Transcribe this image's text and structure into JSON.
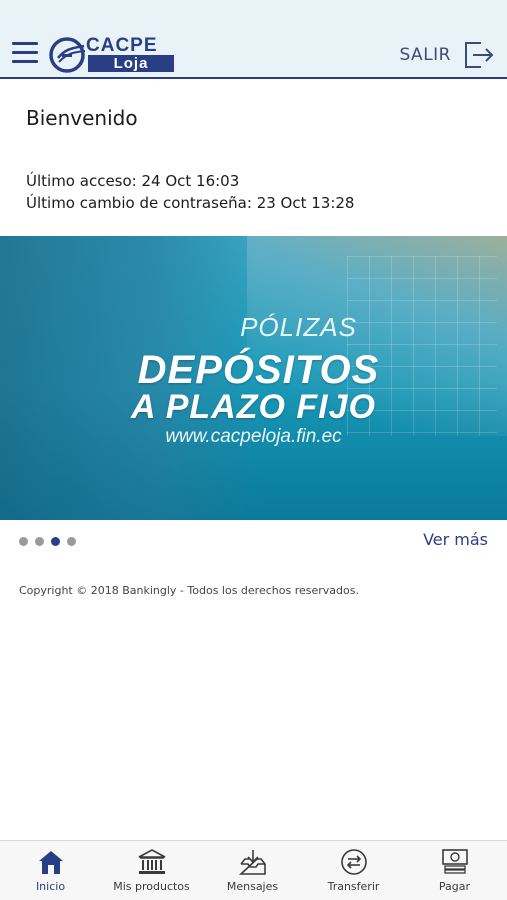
{
  "header": {
    "brand_top": "CACPE",
    "brand_bottom": "Loja",
    "logout_label": "SALIR",
    "colors": {
      "background": "#e9f3f7",
      "brand": "#2a3e86"
    }
  },
  "welcome": {
    "title": "Bienvenido",
    "last_access": "Último acceso: 24 Oct 16:03",
    "last_password_change": "Último cambio de contraseña: 23 Oct 13:28"
  },
  "banner": {
    "line1": "PÓLIZAS",
    "line2": "DEPÓSITOS",
    "line3": "A PLAZO FIJO",
    "url": "www.cacpeloja.fin.ec"
  },
  "carousel": {
    "dot_count": 4,
    "active_index": 2,
    "see_more_label": "Ver más"
  },
  "footer": {
    "copyright": "Copyright © 2018 Bankingly - Todos los derechos reservados."
  },
  "tabbar": {
    "items": [
      {
        "label": "Inicio",
        "icon": "home-icon",
        "active": true
      },
      {
        "label": "Mis productos",
        "icon": "bank-icon",
        "active": false
      },
      {
        "label": "Mensajes",
        "icon": "inbox-icon",
        "active": false
      },
      {
        "label": "Transferir",
        "icon": "transfer-icon",
        "active": false
      },
      {
        "label": "Pagar",
        "icon": "payment-icon",
        "active": false
      }
    ]
  }
}
